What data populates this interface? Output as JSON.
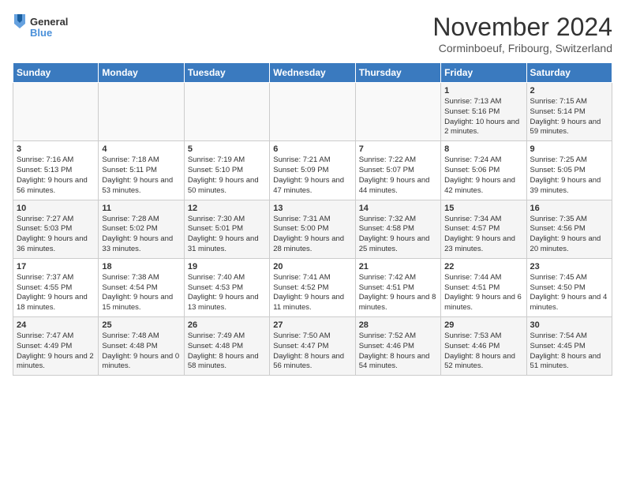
{
  "header": {
    "logo_line1": "General",
    "logo_line2": "Blue",
    "month_title": "November 2024",
    "location": "Corminboeuf, Fribourg, Switzerland"
  },
  "weekdays": [
    "Sunday",
    "Monday",
    "Tuesday",
    "Wednesday",
    "Thursday",
    "Friday",
    "Saturday"
  ],
  "weeks": [
    [
      {
        "day": "",
        "info": ""
      },
      {
        "day": "",
        "info": ""
      },
      {
        "day": "",
        "info": ""
      },
      {
        "day": "",
        "info": ""
      },
      {
        "day": "",
        "info": ""
      },
      {
        "day": "1",
        "info": "Sunrise: 7:13 AM\nSunset: 5:16 PM\nDaylight: 10 hours\nand 2 minutes."
      },
      {
        "day": "2",
        "info": "Sunrise: 7:15 AM\nSunset: 5:14 PM\nDaylight: 9 hours\nand 59 minutes."
      }
    ],
    [
      {
        "day": "3",
        "info": "Sunrise: 7:16 AM\nSunset: 5:13 PM\nDaylight: 9 hours\nand 56 minutes."
      },
      {
        "day": "4",
        "info": "Sunrise: 7:18 AM\nSunset: 5:11 PM\nDaylight: 9 hours\nand 53 minutes."
      },
      {
        "day": "5",
        "info": "Sunrise: 7:19 AM\nSunset: 5:10 PM\nDaylight: 9 hours\nand 50 minutes."
      },
      {
        "day": "6",
        "info": "Sunrise: 7:21 AM\nSunset: 5:09 PM\nDaylight: 9 hours\nand 47 minutes."
      },
      {
        "day": "7",
        "info": "Sunrise: 7:22 AM\nSunset: 5:07 PM\nDaylight: 9 hours\nand 44 minutes."
      },
      {
        "day": "8",
        "info": "Sunrise: 7:24 AM\nSunset: 5:06 PM\nDaylight: 9 hours\nand 42 minutes."
      },
      {
        "day": "9",
        "info": "Sunrise: 7:25 AM\nSunset: 5:05 PM\nDaylight: 9 hours\nand 39 minutes."
      }
    ],
    [
      {
        "day": "10",
        "info": "Sunrise: 7:27 AM\nSunset: 5:03 PM\nDaylight: 9 hours\nand 36 minutes."
      },
      {
        "day": "11",
        "info": "Sunrise: 7:28 AM\nSunset: 5:02 PM\nDaylight: 9 hours\nand 33 minutes."
      },
      {
        "day": "12",
        "info": "Sunrise: 7:30 AM\nSunset: 5:01 PM\nDaylight: 9 hours\nand 31 minutes."
      },
      {
        "day": "13",
        "info": "Sunrise: 7:31 AM\nSunset: 5:00 PM\nDaylight: 9 hours\nand 28 minutes."
      },
      {
        "day": "14",
        "info": "Sunrise: 7:32 AM\nSunset: 4:58 PM\nDaylight: 9 hours\nand 25 minutes."
      },
      {
        "day": "15",
        "info": "Sunrise: 7:34 AM\nSunset: 4:57 PM\nDaylight: 9 hours\nand 23 minutes."
      },
      {
        "day": "16",
        "info": "Sunrise: 7:35 AM\nSunset: 4:56 PM\nDaylight: 9 hours\nand 20 minutes."
      }
    ],
    [
      {
        "day": "17",
        "info": "Sunrise: 7:37 AM\nSunset: 4:55 PM\nDaylight: 9 hours\nand 18 minutes."
      },
      {
        "day": "18",
        "info": "Sunrise: 7:38 AM\nSunset: 4:54 PM\nDaylight: 9 hours\nand 15 minutes."
      },
      {
        "day": "19",
        "info": "Sunrise: 7:40 AM\nSunset: 4:53 PM\nDaylight: 9 hours\nand 13 minutes."
      },
      {
        "day": "20",
        "info": "Sunrise: 7:41 AM\nSunset: 4:52 PM\nDaylight: 9 hours\nand 11 minutes."
      },
      {
        "day": "21",
        "info": "Sunrise: 7:42 AM\nSunset: 4:51 PM\nDaylight: 9 hours\nand 8 minutes."
      },
      {
        "day": "22",
        "info": "Sunrise: 7:44 AM\nSunset: 4:51 PM\nDaylight: 9 hours\nand 6 minutes."
      },
      {
        "day": "23",
        "info": "Sunrise: 7:45 AM\nSunset: 4:50 PM\nDaylight: 9 hours\nand 4 minutes."
      }
    ],
    [
      {
        "day": "24",
        "info": "Sunrise: 7:47 AM\nSunset: 4:49 PM\nDaylight: 9 hours\nand 2 minutes."
      },
      {
        "day": "25",
        "info": "Sunrise: 7:48 AM\nSunset: 4:48 PM\nDaylight: 9 hours\nand 0 minutes."
      },
      {
        "day": "26",
        "info": "Sunrise: 7:49 AM\nSunset: 4:48 PM\nDaylight: 8 hours\nand 58 minutes."
      },
      {
        "day": "27",
        "info": "Sunrise: 7:50 AM\nSunset: 4:47 PM\nDaylight: 8 hours\nand 56 minutes."
      },
      {
        "day": "28",
        "info": "Sunrise: 7:52 AM\nSunset: 4:46 PM\nDaylight: 8 hours\nand 54 minutes."
      },
      {
        "day": "29",
        "info": "Sunrise: 7:53 AM\nSunset: 4:46 PM\nDaylight: 8 hours\nand 52 minutes."
      },
      {
        "day": "30",
        "info": "Sunrise: 7:54 AM\nSunset: 4:45 PM\nDaylight: 8 hours\nand 51 minutes."
      }
    ]
  ]
}
